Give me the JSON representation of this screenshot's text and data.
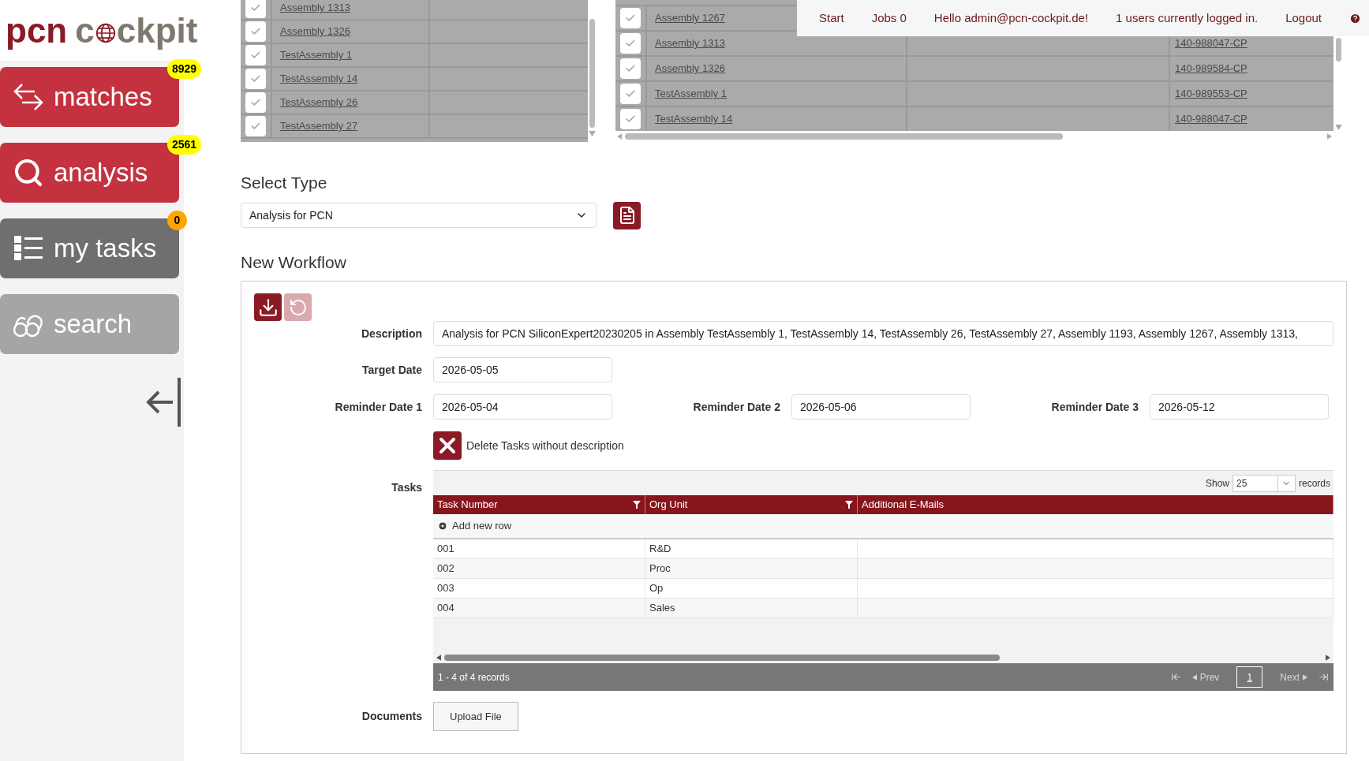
{
  "logo": {
    "brand": "pcn",
    "name_start": "c",
    "name_end": "ckpit"
  },
  "nav_buttons": [
    {
      "kind": "matches",
      "label": "matches",
      "badge": {
        "text": "8929",
        "color": "#ffff00"
      },
      "color": "#c4323f"
    },
    {
      "kind": "analysis",
      "label": "analysis",
      "badge": {
        "text": "2561",
        "color": "#ffff00"
      },
      "color": "#c4323f"
    },
    {
      "kind": "tasks",
      "label": "my tasks",
      "badge": {
        "text": "0",
        "color": "#ffa500"
      },
      "color": "#6f6f6f"
    },
    {
      "kind": "search",
      "label": "search",
      "color": "#a5a5a5"
    }
  ],
  "top_nav": {
    "links": [
      "Start",
      "Jobs 0",
      "Hello admin@pcn-cockpit.de!",
      "1 users currently logged in.",
      "Logout"
    ]
  },
  "assemblies_left": {
    "rows": [
      {
        "name": "Assembly 1313",
        "checked": true
      },
      {
        "name": "Assembly 1326",
        "checked": true
      },
      {
        "name": "TestAssembly 1",
        "checked": true
      },
      {
        "name": "TestAssembly 14",
        "checked": true
      },
      {
        "name": "TestAssembly 26",
        "checked": true
      },
      {
        "name": "TestAssembly 27",
        "checked": true
      }
    ]
  },
  "assemblies_right": {
    "rows": [
      {
        "name": "Assembly 1267",
        "checked": true
      },
      {
        "name": "Assembly 1313",
        "code": "140-988047-CP",
        "checked": true
      },
      {
        "name": "Assembly 1326",
        "code": "140-989584-CP",
        "checked": true
      },
      {
        "name": "TestAssembly 1",
        "code": "140-989553-CP",
        "checked": true
      },
      {
        "name": "TestAssembly 14",
        "code": "140-988047-CP",
        "checked": true
      }
    ]
  },
  "select_type": {
    "title": "Select Type",
    "value": "Analysis for PCN"
  },
  "workflow": {
    "title": "New Workflow",
    "undo_disabled": true,
    "description": {
      "label": "Description",
      "value": "Analysis for PCN SiliconExpert20230205 in Assembly TestAssembly 1, TestAssembly 14, TestAssembly 26, TestAssembly 27, Assembly 1193, Assembly 1267, Assembly 1313,"
    },
    "target_date": {
      "label": "Target Date",
      "value": "2026-05-05"
    },
    "reminders": [
      {
        "label": "Reminder Date 1",
        "value": "2026-05-04"
      },
      {
        "label": "Reminder Date 2",
        "value": "2026-05-06"
      },
      {
        "label": "Reminder Date 3",
        "value": "2026-05-12"
      }
    ],
    "delete_tasks": {
      "label": "Delete Tasks without description",
      "checked": true
    },
    "tasks": {
      "label": "Tasks",
      "show_label": "Show",
      "page_size": "25",
      "records_label": "records",
      "columns": [
        {
          "title": "Task Number",
          "filter": true
        },
        {
          "title": "Org Unit",
          "filter": true
        },
        {
          "title": "Additional E-Mails",
          "filter": false
        }
      ],
      "add_row": "Add new row",
      "rows": [
        [
          "001",
          "R&D",
          ""
        ],
        [
          "002",
          "Proc",
          ""
        ],
        [
          "003",
          "Op",
          ""
        ],
        [
          "004",
          "Sales",
          ""
        ]
      ],
      "summary": "1 - 4 of 4 records",
      "prev": {
        "label": "Prev",
        "disabled": true
      },
      "next": {
        "label": "Next",
        "disabled": true
      },
      "pages": [
        {
          "label": "1",
          "selected": true
        }
      ]
    },
    "documents": {
      "label": "Documents",
      "button": "Upload File"
    }
  }
}
